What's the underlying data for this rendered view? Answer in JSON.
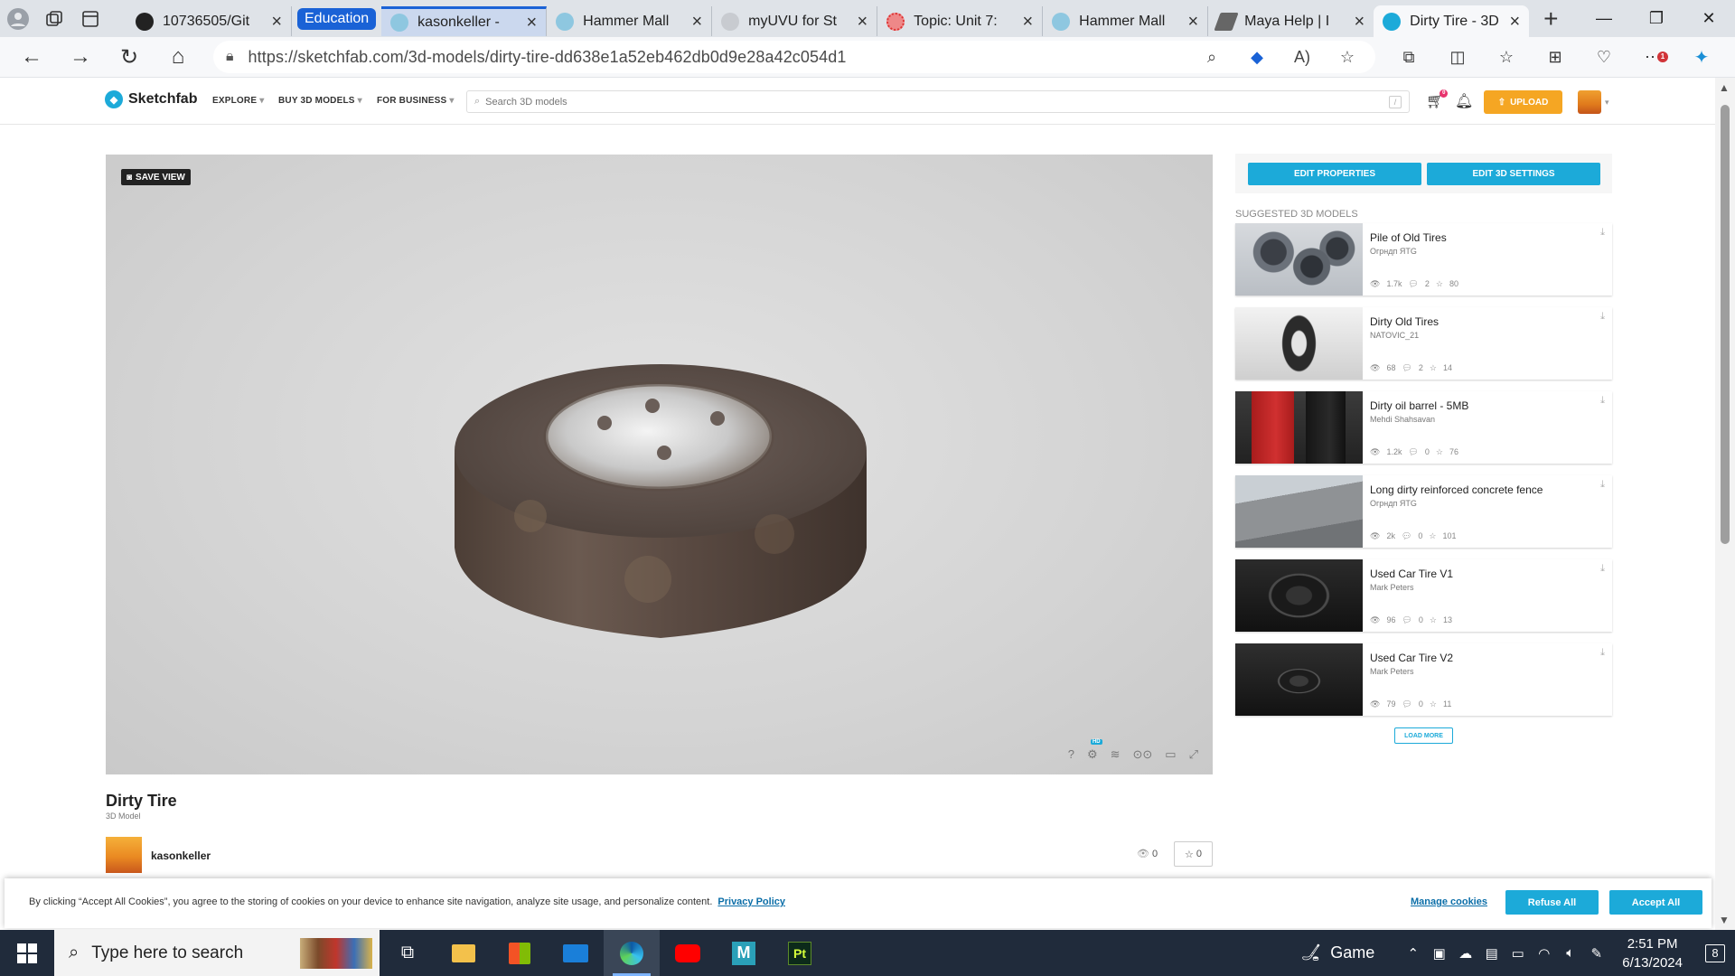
{
  "browser": {
    "tabs": [
      {
        "title": "10736505/Git",
        "favicon_color": "#222222"
      },
      {
        "title": "kasonkeller -",
        "favicon_color": "#1caad9"
      },
      {
        "title": "Hammer Mall",
        "favicon_color": "#1caad9"
      },
      {
        "title": "myUVU for St",
        "favicon_color": "#999999"
      },
      {
        "title": "Topic: Unit 7:",
        "favicon_color": "#e04848"
      },
      {
        "title": "Hammer Mall",
        "favicon_color": "#1caad9"
      },
      {
        "title": "Maya Help | I",
        "favicon_color": "#555555"
      },
      {
        "title": "Dirty Tire - 3D",
        "favicon_color": "#1caad9"
      }
    ],
    "tab_group_label": "Education",
    "new_tab_label": "+",
    "url": "https://sketchfab.com/3d-models/dirty-tire-dd638e1a52eb462db0d9e28a42c054d1",
    "notification_badge": "1"
  },
  "sketchfab": {
    "logo_text": "Sketchfab",
    "nav": {
      "explore": "EXPLORE",
      "buy": "BUY 3D MODELS",
      "business": "FOR BUSINESS"
    },
    "search_placeholder": "Search 3D models",
    "search_shortcut": "/",
    "cart_count": "0",
    "upload_label": "UPLOAD"
  },
  "viewer": {
    "save_view_label": "SAVE VIEW",
    "hd_badge": "HD"
  },
  "sidebar": {
    "edit_properties": "EDIT PROPERTIES",
    "edit_3d_settings": "EDIT 3D SETTINGS",
    "suggested_heading": "SUGGESTED 3D MODELS",
    "models": [
      {
        "title": "Pile of Old Tires",
        "author": "Огрндп ЯТG",
        "views": "1.7k",
        "comments": "2",
        "likes": "80"
      },
      {
        "title": "Dirty Old Tires",
        "author": "NATOVIC_21",
        "views": "68",
        "comments": "2",
        "likes": "14"
      },
      {
        "title": "Dirty oil barrel - 5MB",
        "author": "Mehdi Shahsavan",
        "views": "1.2k",
        "comments": "0",
        "likes": "76"
      },
      {
        "title": "Long dirty reinforced concrete fence",
        "author": "Огрндп ЯТG",
        "views": "2k",
        "comments": "0",
        "likes": "101"
      },
      {
        "title": "Used Car Tire V1",
        "author": "Mark Peters",
        "views": "96",
        "comments": "0",
        "likes": "13"
      },
      {
        "title": "Used Car Tire V2",
        "author": "Mark Peters",
        "views": "79",
        "comments": "0",
        "likes": "11"
      }
    ],
    "load_more": "LOAD MORE"
  },
  "model": {
    "title": "Dirty Tire",
    "type": "3D Model",
    "owner": "kasonkeller",
    "views": "0",
    "likes": "0"
  },
  "cookie_banner": {
    "text": "By clicking “Accept All Cookies”, you agree to the storing of cookies on your device to enhance site navigation, analyze site usage, and personalize content.",
    "privacy_link": "Privacy Policy",
    "manage": "Manage cookies",
    "refuse": "Refuse All",
    "accept": "Accept All"
  },
  "taskbar": {
    "search_placeholder": "Type here to search",
    "game_label": "Game",
    "time": "2:51 PM",
    "date": "6/13/2024",
    "notification_count": "8",
    "maya_label": "M",
    "pt_label": "Pt"
  },
  "colors": {
    "accent": "#1caad9",
    "upload": "#f5a623",
    "taskbar": "#202b3b"
  }
}
